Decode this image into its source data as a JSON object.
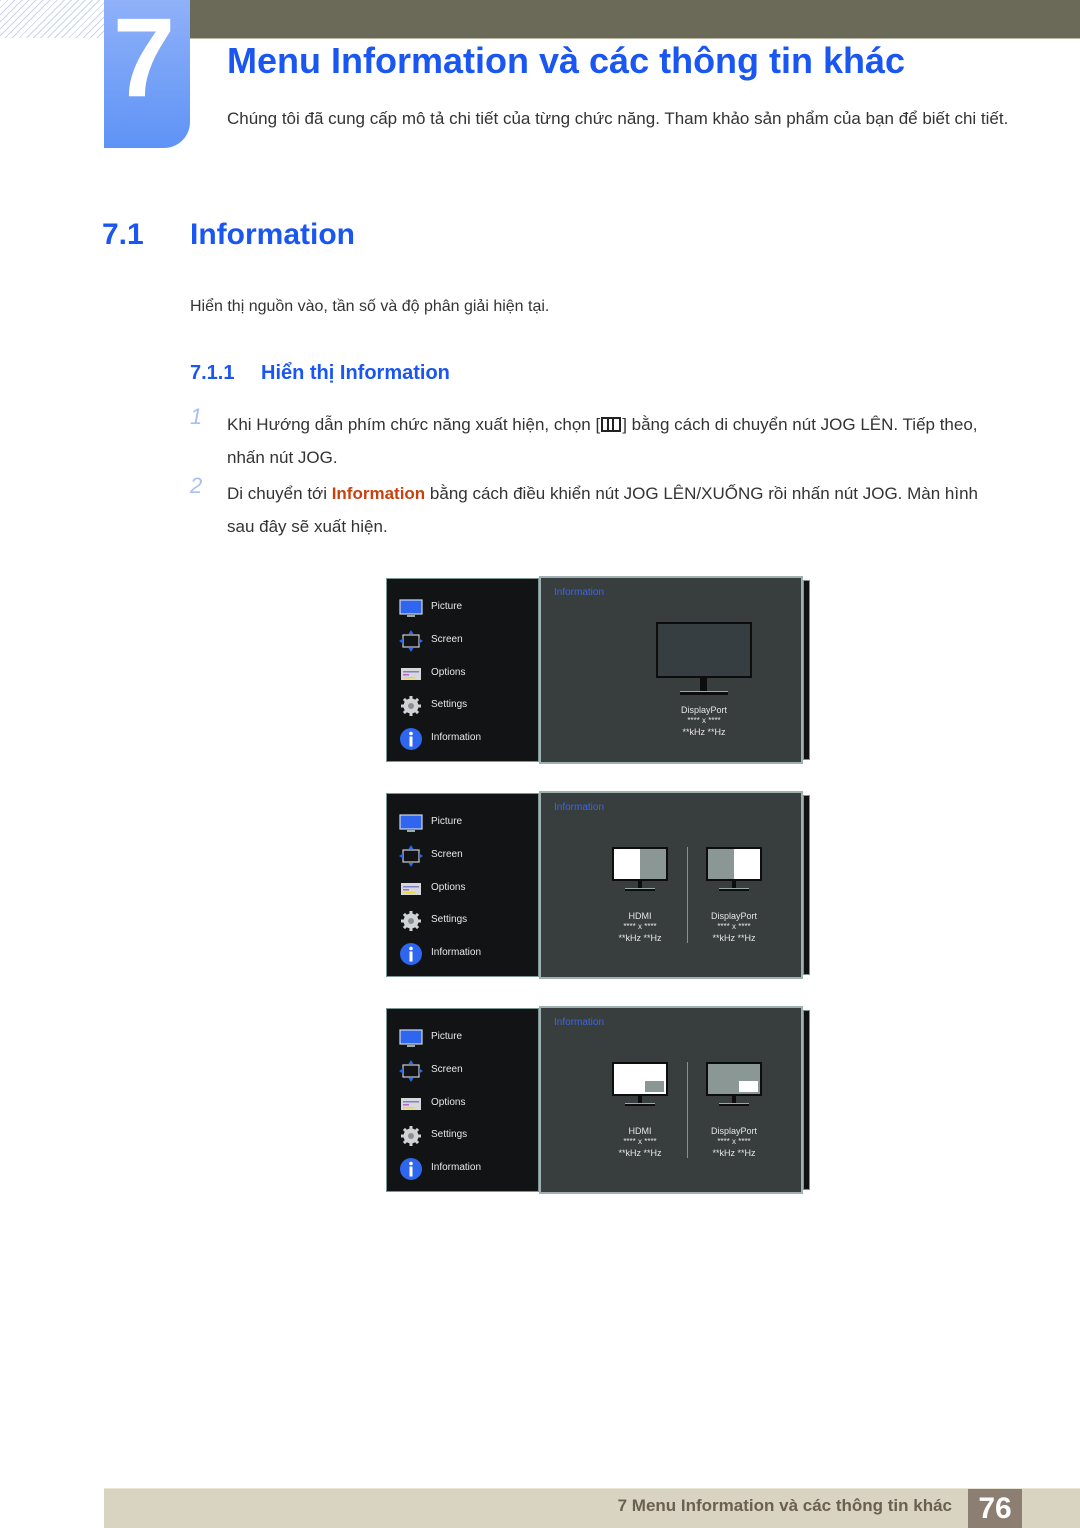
{
  "chapter": {
    "number": "7",
    "title": "Menu Information và các thông tin khác",
    "intro": "Chúng tôi đã cung cấp mô tả chi tiết của từng chức năng. Tham khảo sản phẩm của bạn để biết chi tiết."
  },
  "section": {
    "number": "7.1",
    "title": "Information",
    "description": "Hiển thị nguồn vào, tần số và độ phân giải hiện tại."
  },
  "subsection": {
    "number": "7.1.1",
    "title": "Hiển thị Information"
  },
  "steps": [
    {
      "number": "1",
      "text_before_icon": "Khi Hướng dẫn phím chức năng xuất hiện, chọn [",
      "icon": "menu-grid-icon",
      "text_after_icon": "] bằng cách di chuyển nút JOG LÊN. Tiếp theo, nhấn nút JOG."
    },
    {
      "number": "2",
      "text_before": "Di chuyển tới ",
      "highlight": "Information",
      "text_after": " bằng cách điều khiển nút JOG LÊN/XUỐNG rồi nhấn nút JOG. Màn hình sau đây sẽ xuất hiện."
    }
  ],
  "osd_menu": {
    "items": [
      {
        "label": "Picture",
        "icon": "monitor-icon"
      },
      {
        "label": "Screen",
        "icon": "screen-arrows-icon"
      },
      {
        "label": "Options",
        "icon": "options-icon"
      },
      {
        "label": "Settings",
        "icon": "gear-icon"
      },
      {
        "label": "Information",
        "icon": "info-icon"
      }
    ],
    "panel_title": "Information"
  },
  "screenshots": [
    {
      "mode": "single",
      "sources": [
        {
          "name": "DisplayPort",
          "resolution": "**** x ****",
          "frequency": "**kHz **Hz"
        }
      ]
    },
    {
      "mode": "pbp",
      "sources": [
        {
          "name": "HDMI",
          "resolution": "**** x ****",
          "frequency": "**kHz **Hz"
        },
        {
          "name": "DisplayPort",
          "resolution": "**** x ****",
          "frequency": "**kHz **Hz"
        }
      ]
    },
    {
      "mode": "pip",
      "sources": [
        {
          "name": "HDMI",
          "resolution": "**** x ****",
          "frequency": "**kHz **Hz"
        },
        {
          "name": "DisplayPort",
          "resolution": "**** x ****",
          "frequency": "**kHz **Hz"
        }
      ]
    }
  ],
  "colors": {
    "heading_blue": "#1a56f0",
    "highlight_orange": "#c8410f",
    "osd_panel": "#383d3e",
    "osd_menu": "#121314"
  },
  "footer": {
    "text": "7 Menu Information và các thông tin khác",
    "page_number": "76"
  }
}
